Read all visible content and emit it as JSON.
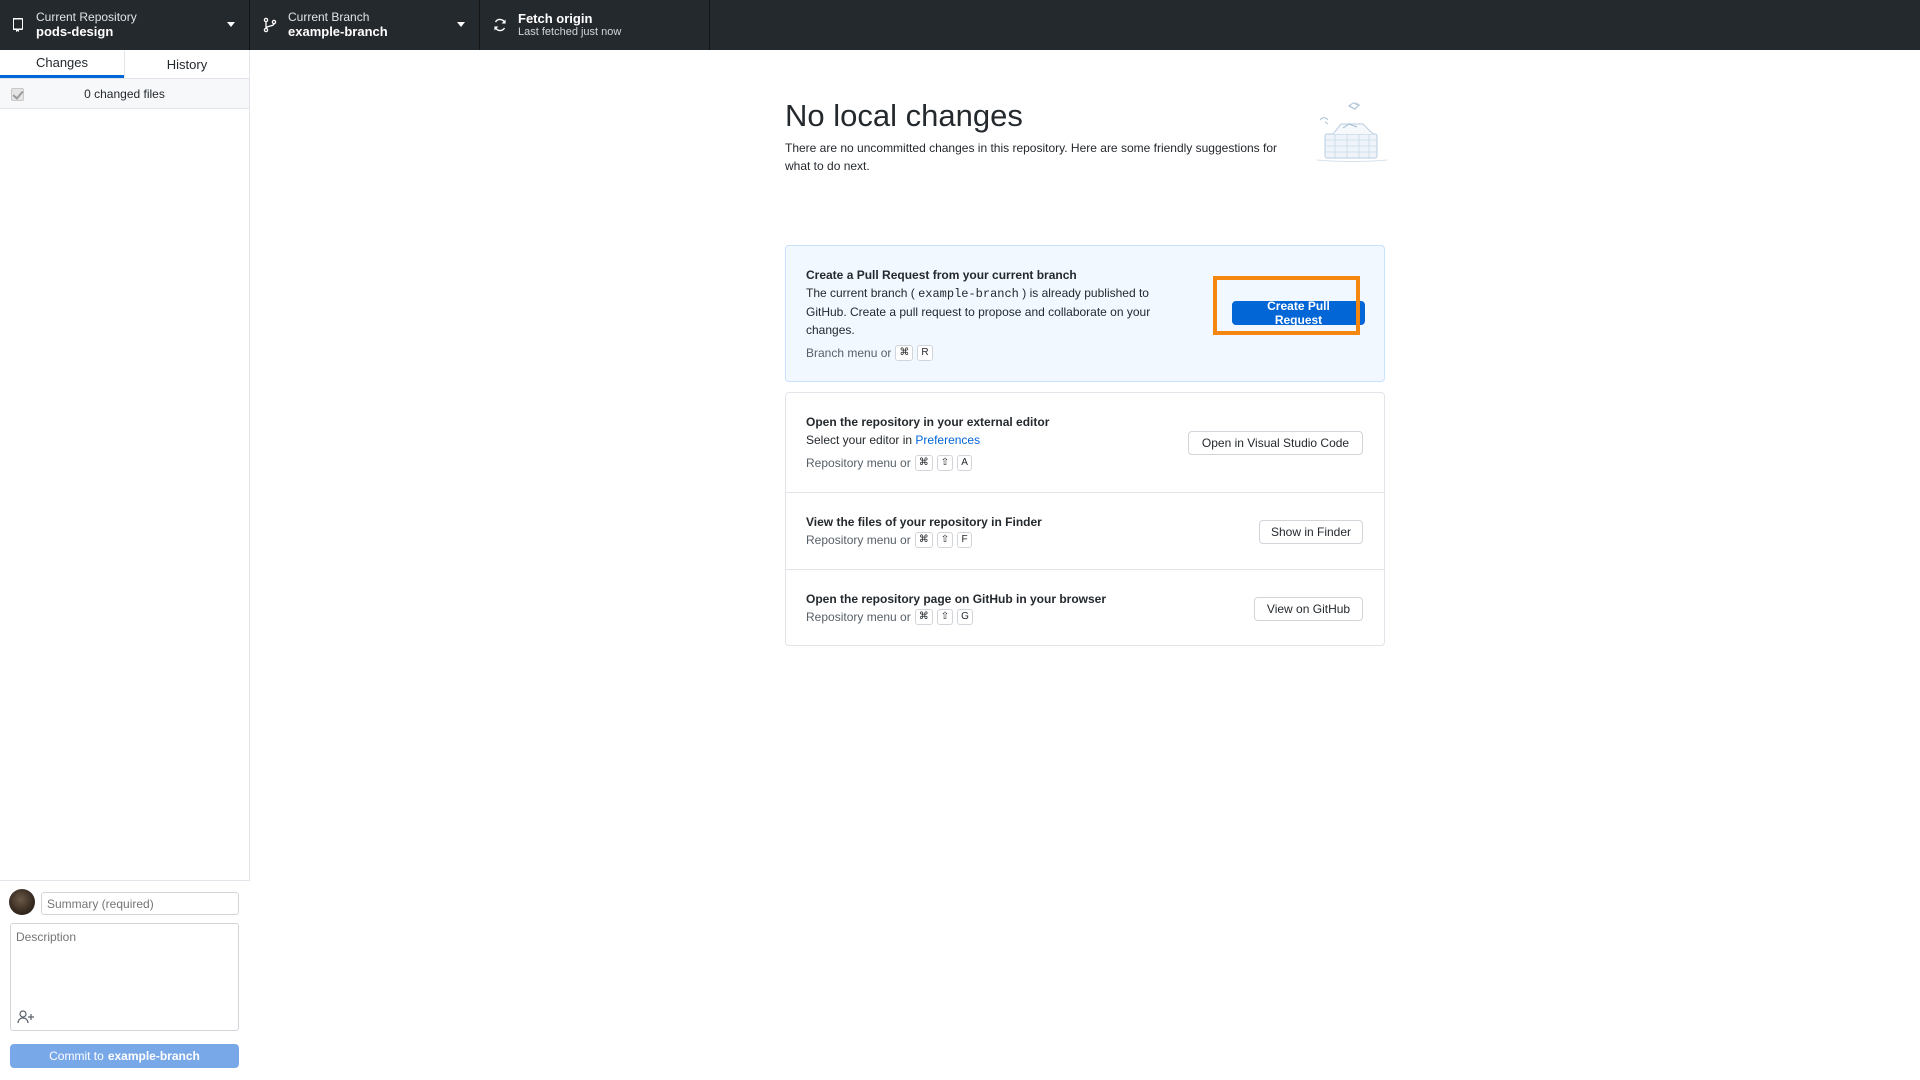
{
  "toolbar": {
    "repository": {
      "label": "Current Repository",
      "value": "pods-design"
    },
    "branch": {
      "label": "Current Branch",
      "value": "example-branch"
    },
    "fetch": {
      "label": "Fetch origin",
      "sub": "Last fetched just now"
    }
  },
  "sidebar": {
    "tabs": [
      {
        "label": "Changes",
        "active": true
      },
      {
        "label": "History",
        "active": false
      }
    ],
    "changes_count": "0 changed files",
    "commit": {
      "summary_placeholder": "Summary (required)",
      "description_placeholder": "Description",
      "button_prefix": "Commit to",
      "button_branch": "example-branch"
    }
  },
  "main": {
    "title": "No local changes",
    "subtitle": "There are no uncommitted changes in this repository. Here are some friendly suggestions for what to do next.",
    "pull_request": {
      "title": "Create a Pull Request from your current branch",
      "desc_before": "The current branch (",
      "desc_branch": "example-branch",
      "desc_after": ") is already published to GitHub. Create a pull request to propose and collaborate on your changes.",
      "shortcut_label": "Branch menu or",
      "keys": [
        "⌘",
        "R"
      ],
      "button": "Create Pull Request"
    },
    "editor": {
      "title": "Open the repository in your external editor",
      "desc_before": "Select your editor in",
      "desc_link": "Preferences",
      "shortcut_label": "Repository menu or",
      "keys": [
        "⌘",
        "⇧",
        "A"
      ],
      "button": "Open in Visual Studio Code"
    },
    "finder": {
      "title": "View the files of your repository in Finder",
      "shortcut_label": "Repository menu or",
      "keys": [
        "⌘",
        "⇧",
        "F"
      ],
      "button": "Show in Finder"
    },
    "github": {
      "title": "Open the repository page on GitHub in your browser",
      "shortcut_label": "Repository menu or",
      "keys": [
        "⌘",
        "⇧",
        "G"
      ],
      "button": "View on GitHub"
    }
  },
  "colors": {
    "toolbar_bg": "#24292e",
    "accent": "#0366d6",
    "highlight": "#f5860f",
    "commit_button": "#79a8e8"
  }
}
